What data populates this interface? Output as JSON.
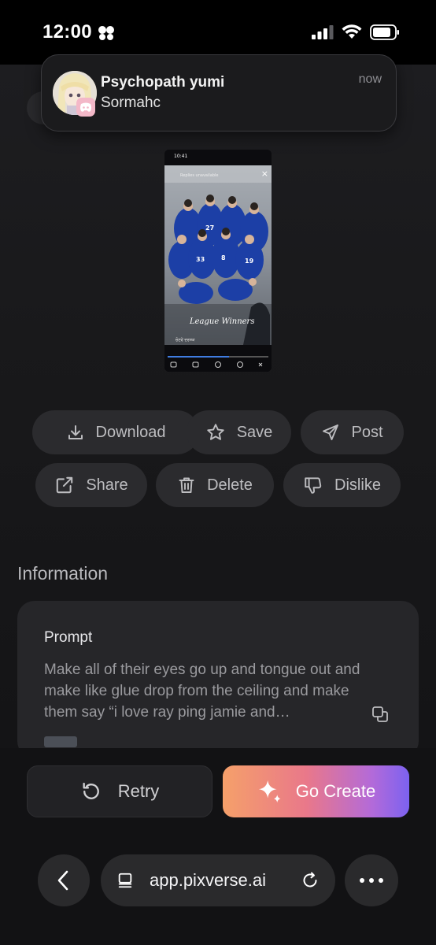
{
  "status_bar": {
    "time": "12:00"
  },
  "notification": {
    "title": "Psychopath yumi",
    "body": "Sormahc",
    "time": "now"
  },
  "media_preview": {
    "status_time": "10:41",
    "profile_text": "Replies unavailable",
    "caption": "League Winners",
    "footer_text": "ਚੋਣਵੇਂ ਦਰਸ਼ਕ"
  },
  "actions": {
    "download": "Download",
    "save": "Save",
    "post": "Post",
    "share": "Share",
    "delete": "Delete",
    "dislike": "Dislike"
  },
  "information": {
    "heading": "Information",
    "prompt_label": "Prompt",
    "prompt_text": "Make all of their eyes go up and tongue out and make like glue drop from the ceiling and make them say “i love ray ping jamie and…"
  },
  "bottom_actions": {
    "retry": "Retry",
    "go_create": "Go Create"
  },
  "browser": {
    "url": "app.pixverse.ai"
  },
  "colors": {
    "accent_gradient_start": "#f5a06a",
    "accent_gradient_end": "#7c62f0",
    "background": "#161618"
  }
}
